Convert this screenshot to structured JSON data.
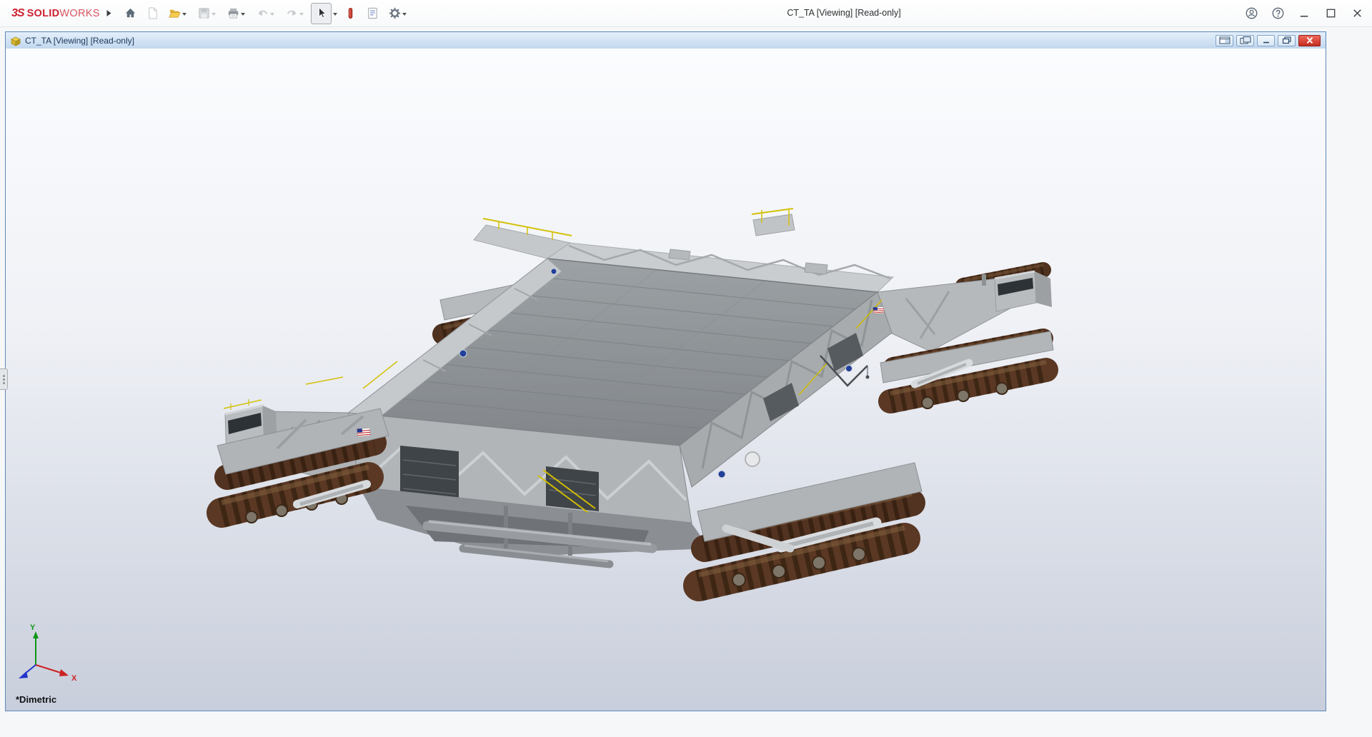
{
  "app": {
    "brand": {
      "mark": "3S",
      "name_primary": "SOLID",
      "name_secondary": "WORKS"
    },
    "title": "CT_TA [Viewing] [Read-only]",
    "toolbar_icons": [
      {
        "name": "breadcrumb-arrow-icon",
        "enabled": true
      },
      {
        "name": "home-icon",
        "enabled": true
      },
      {
        "name": "new-document-icon",
        "enabled": false
      },
      {
        "name": "open-icon",
        "enabled": true,
        "dropdown": true
      },
      {
        "name": "save-icon",
        "enabled": false,
        "dropdown": true
      },
      {
        "name": "print-icon",
        "enabled": true,
        "dropdown": true
      },
      {
        "name": "undo-icon",
        "enabled": false,
        "dropdown": true
      },
      {
        "name": "redo-icon",
        "enabled": false,
        "dropdown": true
      },
      {
        "name": "select-cursor-icon",
        "enabled": true,
        "active": true,
        "dropdown": true
      },
      {
        "name": "red-tool-icon",
        "enabled": true
      },
      {
        "name": "file-properties-icon",
        "enabled": true
      },
      {
        "name": "options-gear-icon",
        "enabled": true,
        "dropdown": true
      }
    ],
    "window_controls": [
      {
        "name": "user-account-icon"
      },
      {
        "name": "help-icon"
      },
      {
        "name": "minimize-icon"
      },
      {
        "name": "maximize-icon"
      },
      {
        "name": "close-icon"
      }
    ]
  },
  "child": {
    "title": "CT_TA [Viewing] [Read-only]",
    "doc_icon": "assembly-document-icon",
    "controls": [
      {
        "name": "tile-window-icon"
      },
      {
        "name": "cascade-window-icon"
      },
      {
        "name": "minimize-icon"
      },
      {
        "name": "restore-icon"
      },
      {
        "name": "close-icon"
      }
    ]
  },
  "viewport": {
    "view_label": "*Dimetric",
    "model": "crawler-transporter-3d-model",
    "triad": {
      "x_label": "X",
      "y_label": "Y"
    },
    "background_top": "#fbfcfe",
    "background_bottom": "#c8cedb"
  },
  "colors": {
    "brand_red": "#cf2030",
    "track_brown": "#54331f",
    "body_gray": "#b3b7ba",
    "deck_gray": "#8f9397",
    "railing_yellow": "#d2be00",
    "child_titlebar_blue": "#c2d8ee",
    "close_button_red": "#c22d20",
    "nasa_blue": "#20409a"
  }
}
